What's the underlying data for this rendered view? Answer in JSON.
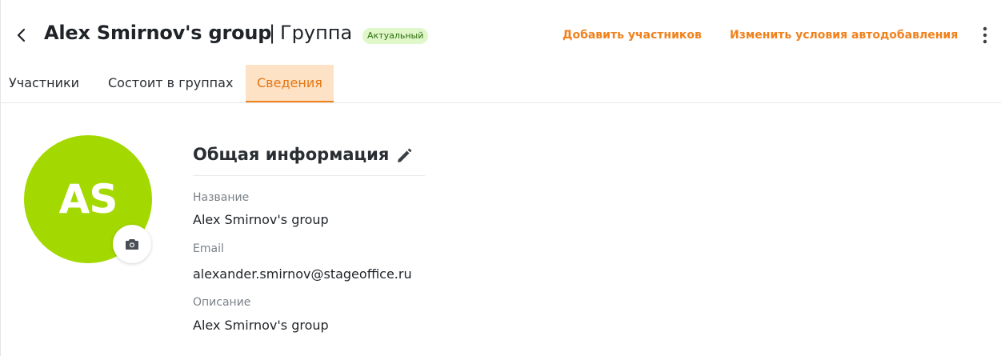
{
  "header": {
    "title": "Alex Smirnov's group",
    "separator": "|",
    "subtitle": "Группа",
    "status_badge": "Актуальный",
    "add_members_label": "Добавить участников",
    "auto_add_label": "Изменить условия автодобавления"
  },
  "tabs": [
    {
      "label": "Участники",
      "active": false
    },
    {
      "label": "Состоит в группах",
      "active": false
    },
    {
      "label": "Сведения",
      "active": true
    }
  ],
  "avatar": {
    "initials": "AS",
    "color": "#a3d900"
  },
  "info": {
    "section_title": "Общая информация",
    "fields": [
      {
        "label": "Название",
        "value": "Alex Smirnov's group"
      },
      {
        "label": "Email",
        "value": "alexander.smirnov@stageoffice.ru"
      },
      {
        "label": "Описание",
        "value": "Alex Smirnov's group"
      }
    ]
  },
  "icons": {
    "back": "chevron-left-icon",
    "more": "more-vertical-icon",
    "camera": "camera-icon",
    "edit": "pencil-icon"
  },
  "colors": {
    "accent": "#f0811c",
    "active_tab_bg": "#fde2c6",
    "badge_bg": "#dff7c9",
    "badge_text": "#2f6f0e"
  }
}
